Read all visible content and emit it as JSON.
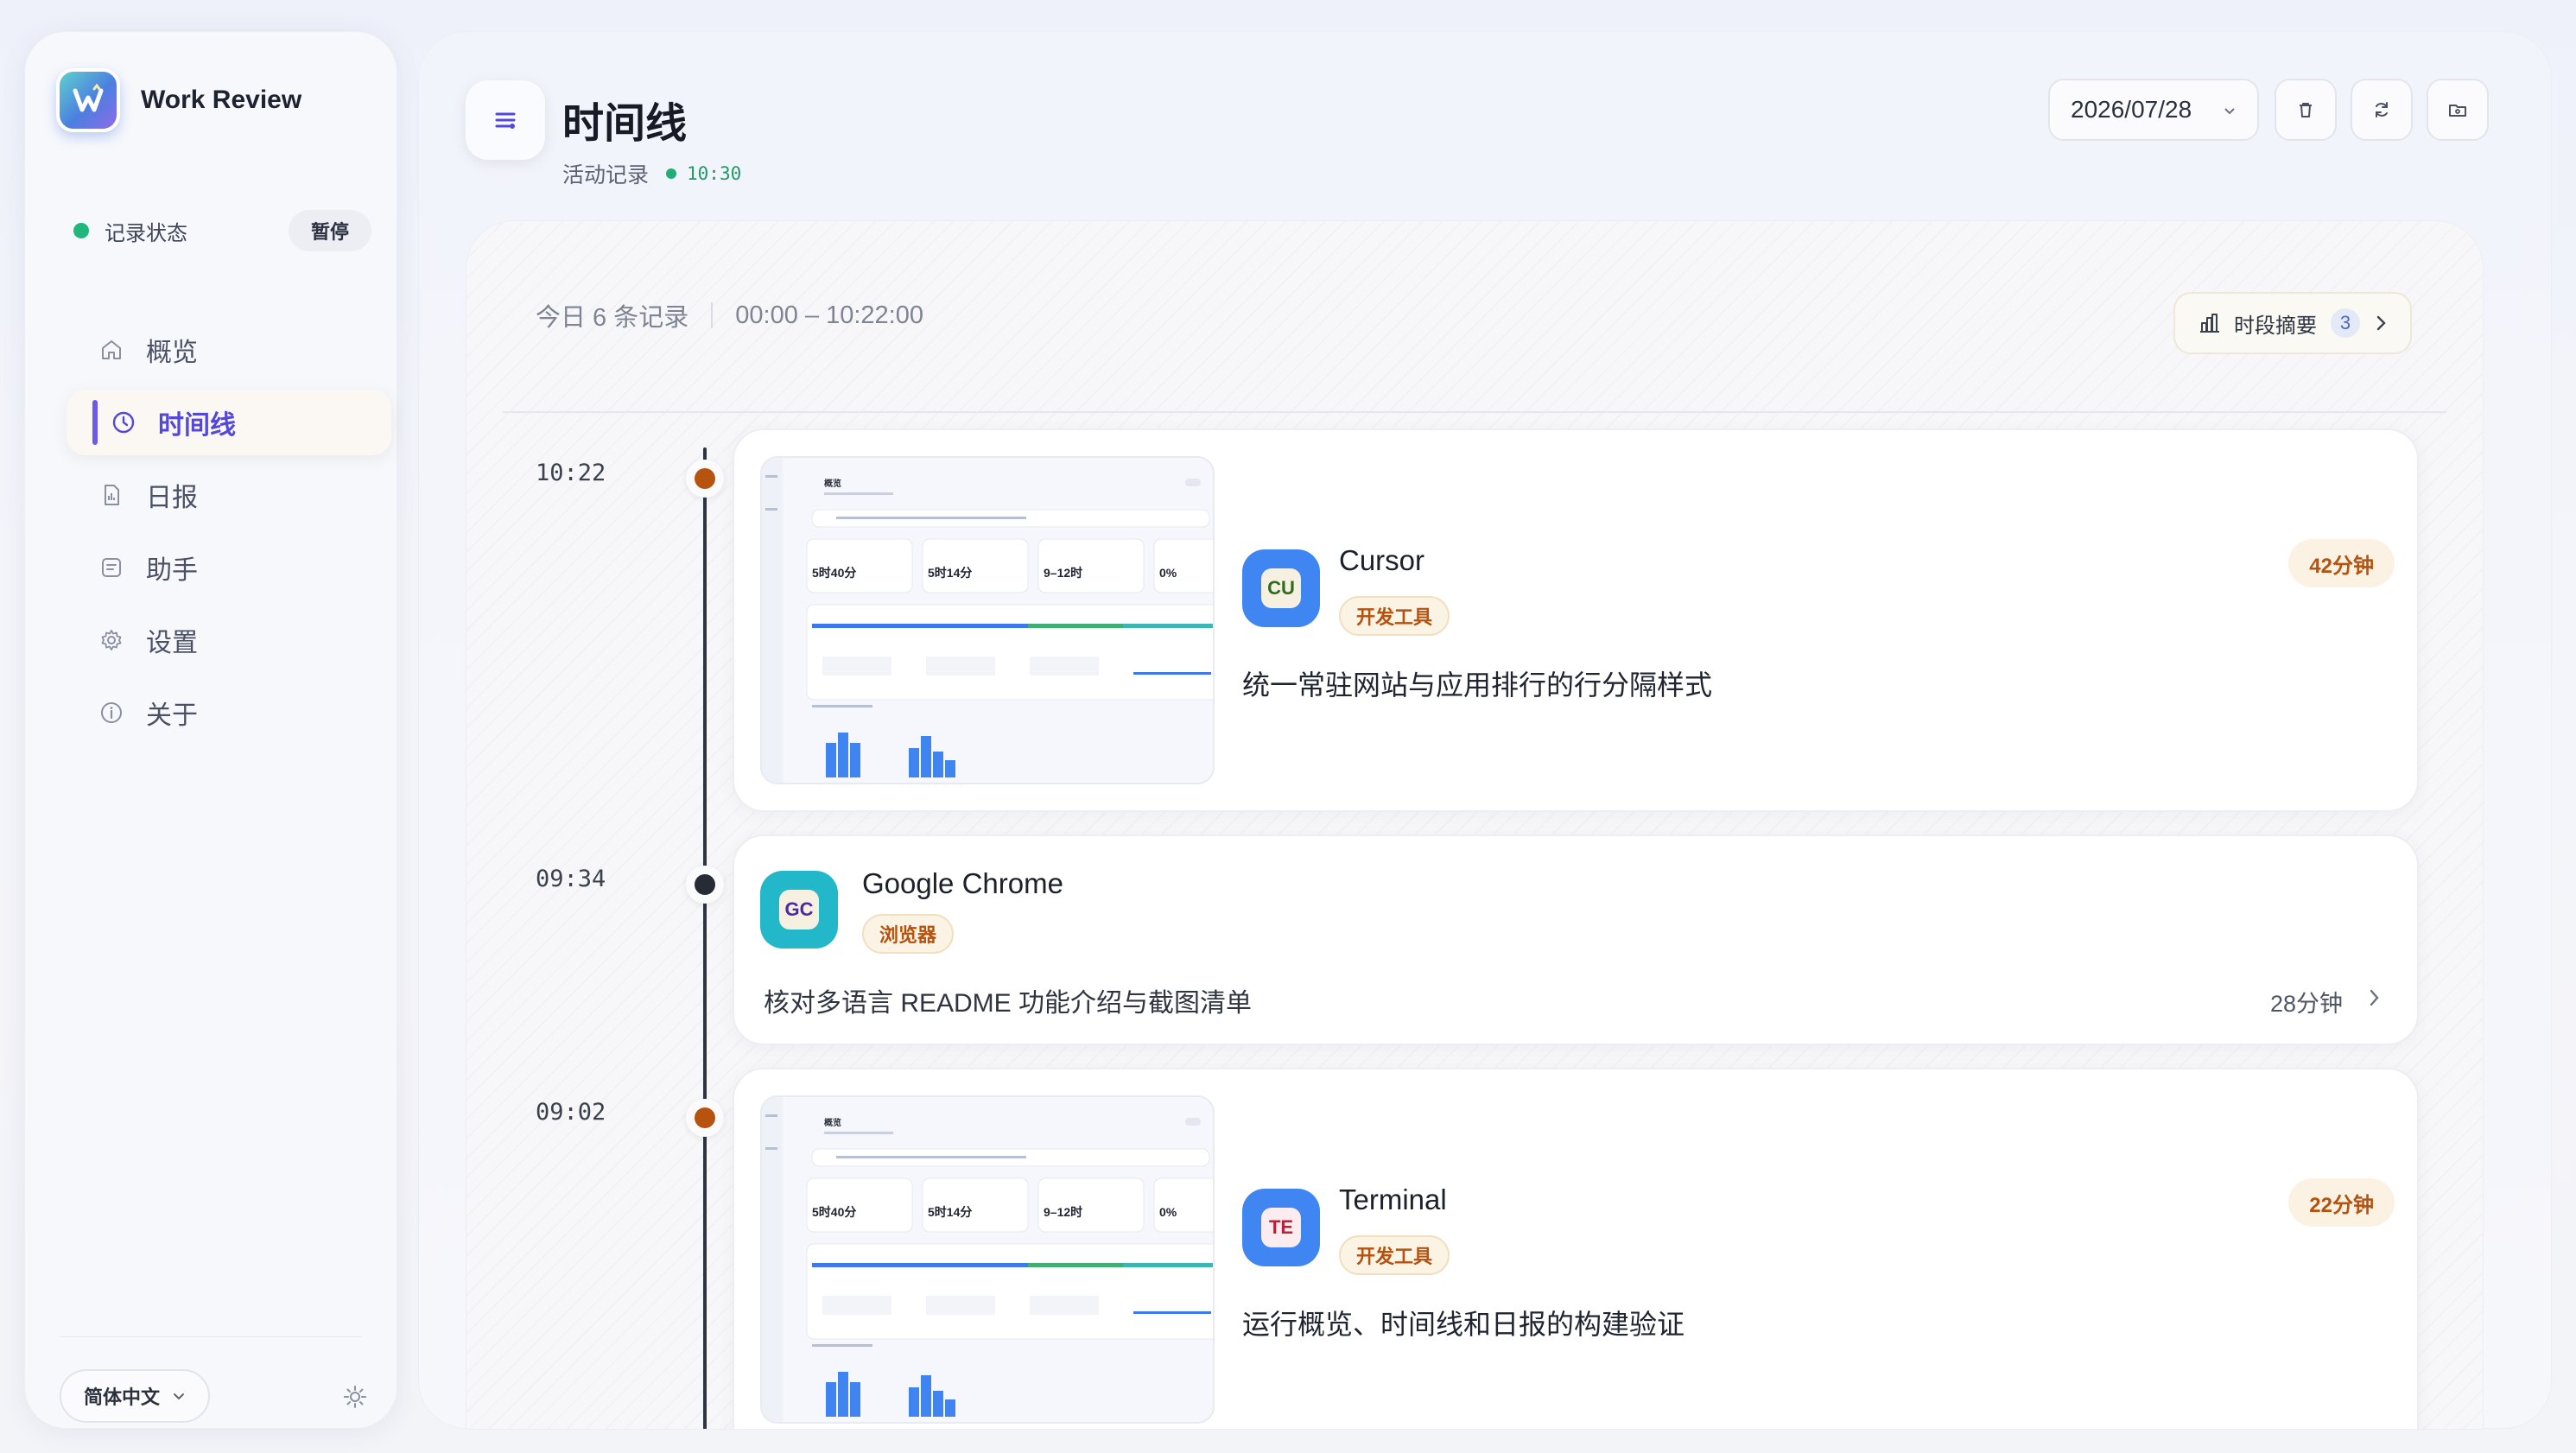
{
  "app": {
    "name": "Work Review"
  },
  "sidebar": {
    "record_status_label": "记录状态",
    "pause_label": "暂停",
    "nav": [
      {
        "label": "概览",
        "icon": "home-icon"
      },
      {
        "label": "时间线",
        "icon": "clock-icon",
        "active": true
      },
      {
        "label": "日报",
        "icon": "document-icon"
      },
      {
        "label": "助手",
        "icon": "assistant-icon"
      },
      {
        "label": "设置",
        "icon": "gear-icon"
      },
      {
        "label": "关于",
        "icon": "info-icon"
      }
    ],
    "language_label": "简体中文"
  },
  "header": {
    "title": "时间线",
    "subtitle": "活动记录",
    "live_time": "10:30",
    "date_value": "2026/07/28"
  },
  "panel": {
    "records_count_text": "今日 6 条记录",
    "time_range_text": "00:00 – 10:22:00",
    "summary_label": "时段摘要",
    "summary_count": "3"
  },
  "timeline": [
    {
      "time": "10:22",
      "dot_color": "#b6530f",
      "app_abbr": "CU",
      "app_name": "Cursor",
      "category": "开发工具",
      "duration": "42分钟",
      "description": "统一常驻网站与应用排行的行分隔样式"
    },
    {
      "time": "09:34",
      "dot_color": "#262b35",
      "app_abbr": "GC",
      "app_name": "Google Chrome",
      "category": "浏览器",
      "duration": "28分钟",
      "description": "核对多语言 README 功能介绍与截图清单"
    },
    {
      "time": "09:02",
      "dot_color": "#b6530f",
      "app_abbr": "TE",
      "app_name": "Terminal",
      "category": "开发工具",
      "duration": "22分钟",
      "description": "运行概览、时间线和日报的构建验证"
    }
  ],
  "thumbnail": {
    "title": "概览",
    "stats": [
      "5时40分",
      "5时14分",
      "9–12时",
      "0%"
    ]
  },
  "colors": {
    "accent": "#5348d8",
    "record_green": "#21b77c",
    "tag_orange": "#b4520f",
    "app_blue": "#3f86f2",
    "chrome_teal": "#22b7c9"
  }
}
